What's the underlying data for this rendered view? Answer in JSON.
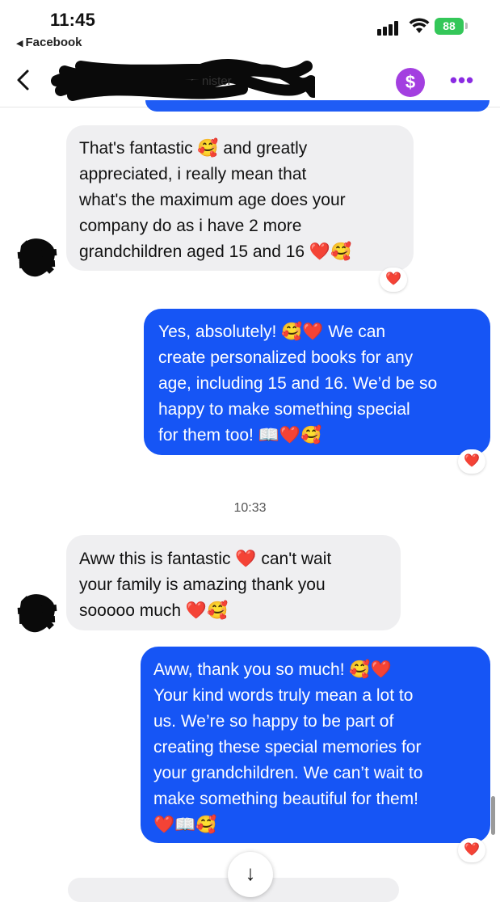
{
  "status": {
    "time": "11:45",
    "back_app_label": "Facebook",
    "battery": "88"
  },
  "header": {
    "contact_name_visible": "nister"
  },
  "messages": [
    {
      "direction": "in",
      "lines": [
        "That's fantastic 🥰 and greatly",
        "appreciated, i really mean that",
        "what's the maximum age does your",
        "company do as i have 2 more",
        "grandchildren aged 15 and 16 ❤️🥰"
      ],
      "reaction": "❤️"
    },
    {
      "direction": "out",
      "lines": [
        "Yes, absolutely! 🥰❤️ We can",
        "create personalized books for any",
        "age, including 15 and 16. We’d be so",
        "happy to make something special",
        "for them too! 📖❤️🥰"
      ],
      "reaction": "❤️"
    },
    {
      "direction": "in",
      "lines": [
        "Aww this is fantastic ❤️ can't wait",
        "your family is amazing thank you",
        "sooooo much ❤️🥰"
      ]
    },
    {
      "direction": "out",
      "lines": [
        "Aww, thank you so much! 🥰❤️",
        "Your kind words truly mean a lot to",
        "us. We’re so happy to be part of",
        "creating these special memories for",
        "your grandchildren. We can’t wait to",
        "make something beautiful for them!",
        "❤️📖🥰"
      ],
      "reaction": "❤️"
    }
  ],
  "timestamp": "10:33",
  "colors": {
    "outgoing_bubble": "#1655f5",
    "incoming_bubble": "#efeff1",
    "pay_button": "#a33fe0",
    "reaction_heart": "#e0262b"
  },
  "icons": {
    "back": "chevron-left-icon",
    "pay": "dollar-icon",
    "more": "more-dots-icon",
    "scroll": "arrow-down-icon"
  }
}
